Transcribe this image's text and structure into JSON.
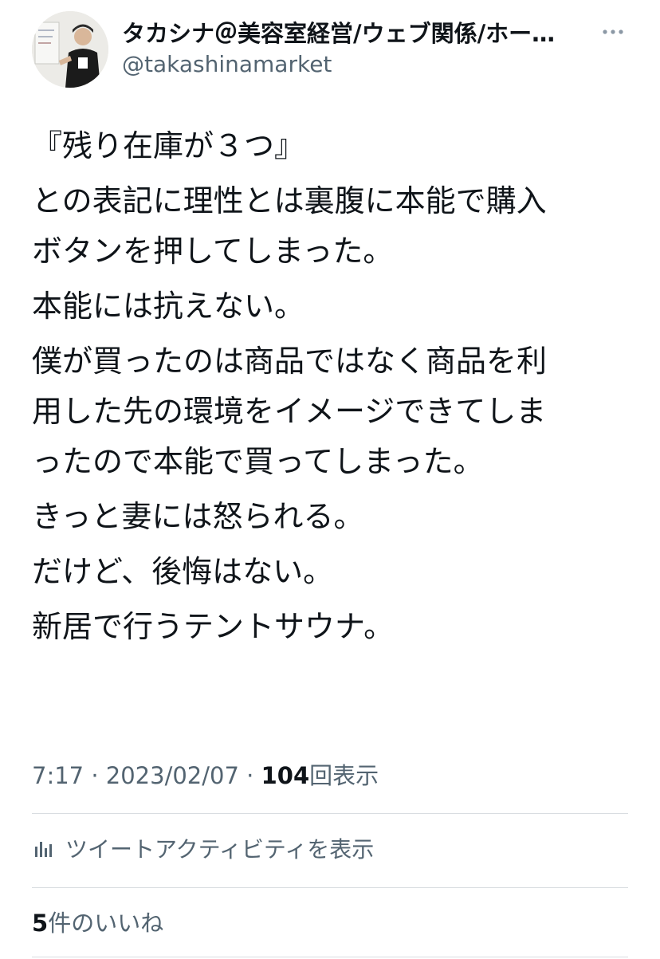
{
  "author": {
    "display_name": "タカシナ＠美容室経営/ウェブ関係/ホー…",
    "handle": "@takashinamarket"
  },
  "tweet": {
    "paragraphs": [
      "『残り在庫が３つ』",
      "との表記に理性とは裏腹に本能で購入\nボタンを押してしまった。",
      "本能には抗えない。",
      "僕が買ったのは商品ではなく商品を利\n用した先の環境をイメージできてしま\nったので本能で買ってしまった。",
      "きっと妻には怒られる。",
      "だけど、後悔はない。",
      "新居で行うテントサウナ。"
    ]
  },
  "meta": {
    "time": "7:17",
    "separator": "·",
    "date": "2023/02/07",
    "views_count": "104",
    "views_label": "回表示"
  },
  "activity": {
    "label": "ツイートアクティビティを表示"
  },
  "likes": {
    "count": "5",
    "label": "件のいいね"
  },
  "icons": {
    "more": "more-horizontal-icon",
    "activity": "bar-chart-icon"
  },
  "colors": {
    "text_primary": "#0f1419",
    "text_secondary": "#536471",
    "divider": "#d9dde1"
  }
}
